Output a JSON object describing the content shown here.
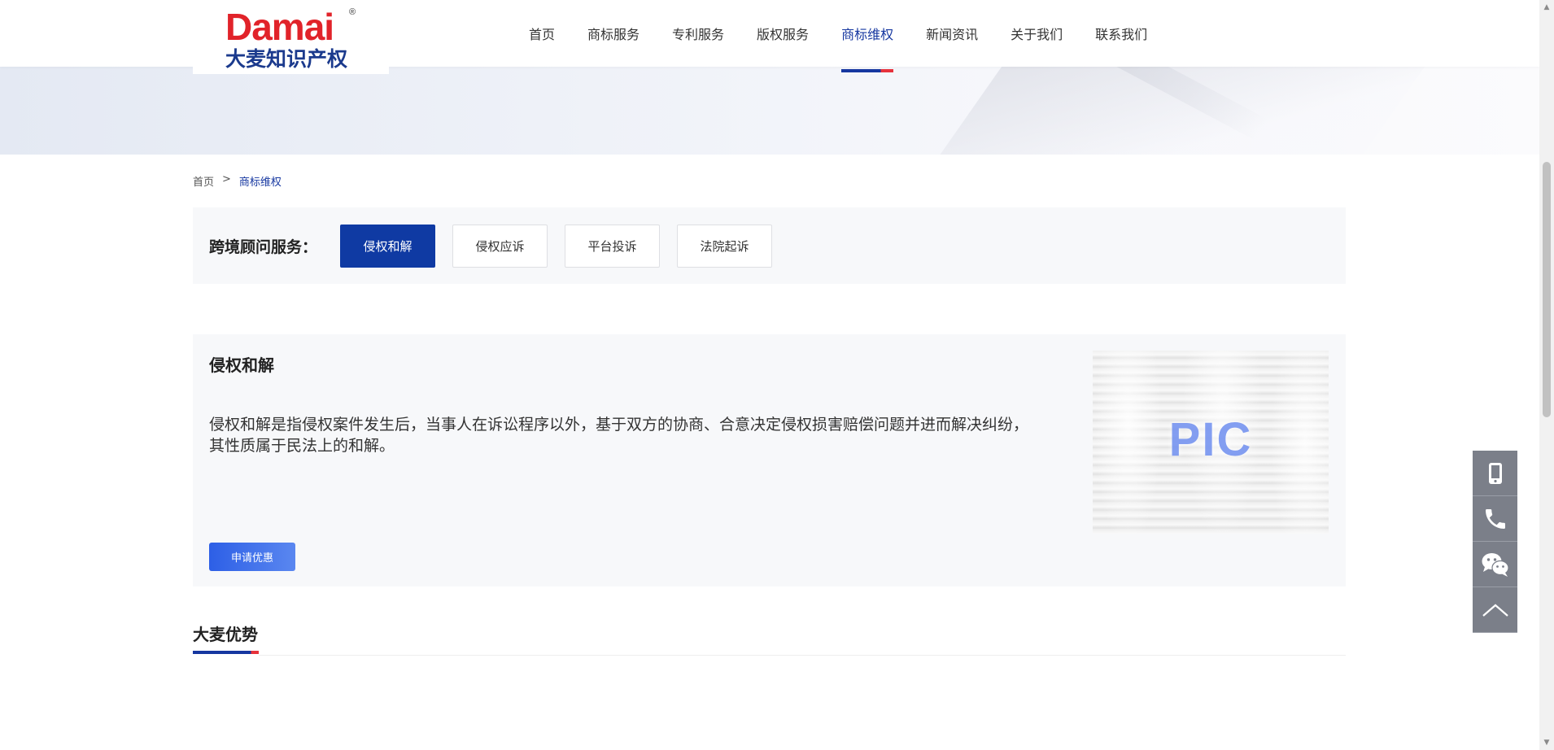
{
  "logo": {
    "brand": "Damai",
    "registered": "®",
    "tagline": "大麦知识产权"
  },
  "nav": {
    "items": [
      {
        "label": "首页"
      },
      {
        "label": "商标服务"
      },
      {
        "label": "专利服务"
      },
      {
        "label": "版权服务"
      },
      {
        "label": "商标维权",
        "active": true
      },
      {
        "label": "新闻资讯"
      },
      {
        "label": "关于我们"
      },
      {
        "label": "联系我们"
      }
    ]
  },
  "breadcrumb": {
    "home": "首页",
    "separator": ">",
    "current": "商标维权"
  },
  "services": {
    "title": "跨境顾问服务：",
    "tabs": [
      {
        "label": "侵权和解",
        "active": true
      },
      {
        "label": "侵权应诉"
      },
      {
        "label": "平台投诉"
      },
      {
        "label": "法院起诉"
      }
    ]
  },
  "panel": {
    "title": "侵权和解",
    "description": "侵权和解是指侵权案件发生后，当事人在诉讼程序以外，基于双方的协商、合意决定侵权损害赔偿问题并进而解决纠纷，其性质属于民法上的和解。",
    "apply_button": "申请优惠",
    "image_label": "PIC"
  },
  "advantages": {
    "title": "大麦优势"
  },
  "side_bar": {
    "items": [
      {
        "icon": "mobile-phone-icon"
      },
      {
        "icon": "phone-icon"
      },
      {
        "icon": "wechat-icon"
      },
      {
        "icon": "back-to-top-icon"
      }
    ]
  },
  "colors": {
    "brand_blue": "#0f3aa3",
    "nav_active": "#1637a0",
    "brand_red": "#e1232a",
    "apply_button": "#2d5fe6",
    "side_bar": "#7b7f89"
  }
}
